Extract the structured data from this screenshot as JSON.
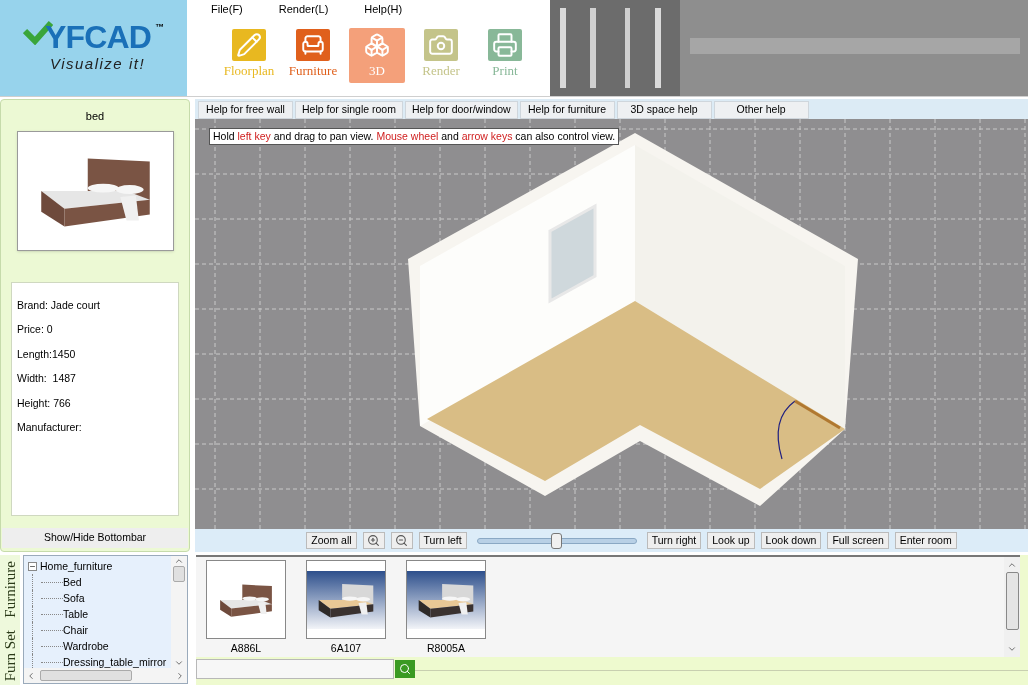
{
  "logo": {
    "name": "YFCAD",
    "trademark": "™",
    "tagline": "Visualize it!"
  },
  "menu": [
    "File(F)",
    "Render(L)",
    "Help(H)"
  ],
  "toolbar": [
    {
      "kind": "floorplan",
      "label": "Floorplan",
      "color": "#e8b820",
      "selected": false
    },
    {
      "kind": "furniture",
      "label": "Furniture",
      "color": "#e0601c",
      "selected": false
    },
    {
      "kind": "cube",
      "label": "3D",
      "color": "#f4a07a",
      "selected": true
    },
    {
      "kind": "render",
      "label": "Render",
      "color": "#c4c48a",
      "selected": false
    },
    {
      "kind": "print",
      "label": "Print",
      "color": "#88b898",
      "selected": false
    }
  ],
  "product": {
    "title": "bed",
    "details": [
      "Brand: Jade court",
      "Price: 0",
      "Length:1450",
      "Width:  1487",
      "Height: 766",
      "Manufacturer:"
    ],
    "toggle_button": "Show/Hide Bottombar"
  },
  "help_tabs": [
    "Help for free wall",
    "Help for single room",
    "Help for door/window",
    "Help for furniture",
    "3D space help",
    "Other help"
  ],
  "tooltip": [
    {
      "text": "Hold ",
      "highlight": false
    },
    {
      "text": "left key",
      "highlight": true
    },
    {
      "text": " and drag to pan view. ",
      "highlight": false
    },
    {
      "text": "Mouse wheel",
      "highlight": true
    },
    {
      "text": " and ",
      "highlight": false
    },
    {
      "text": "arrow keys",
      "highlight": true
    },
    {
      "text": " can also control view.",
      "highlight": false
    }
  ],
  "view_controls": [
    {
      "kind": "button",
      "label": "Zoom all"
    },
    {
      "kind": "zoom_in"
    },
    {
      "kind": "zoom_out"
    },
    {
      "kind": "button",
      "label": "Turn left"
    },
    {
      "kind": "slider",
      "level": 0.5
    },
    {
      "kind": "button",
      "label": "Turn right"
    },
    {
      "kind": "button",
      "label": "Look up"
    },
    {
      "kind": "button",
      "label": "Look down"
    },
    {
      "kind": "button",
      "label": "Full screen"
    },
    {
      "kind": "button",
      "label": "Enter room"
    }
  ],
  "side_tabs": [
    "Furn Set",
    "Furnirure"
  ],
  "tree": {
    "label": "Home_furniture",
    "expanded": true,
    "children": [
      {
        "label": "Bed"
      },
      {
        "label": "Sofa"
      },
      {
        "label": "Table"
      },
      {
        "label": "Chair"
      },
      {
        "label": "Wardrobe"
      },
      {
        "label": "Dressing_table_mirror"
      }
    ]
  },
  "catalog": [
    {
      "code": "A886L",
      "kind": "plain"
    },
    {
      "code": "6A107",
      "kind": "studio"
    },
    {
      "code": "R8005A",
      "kind": "studio"
    }
  ]
}
